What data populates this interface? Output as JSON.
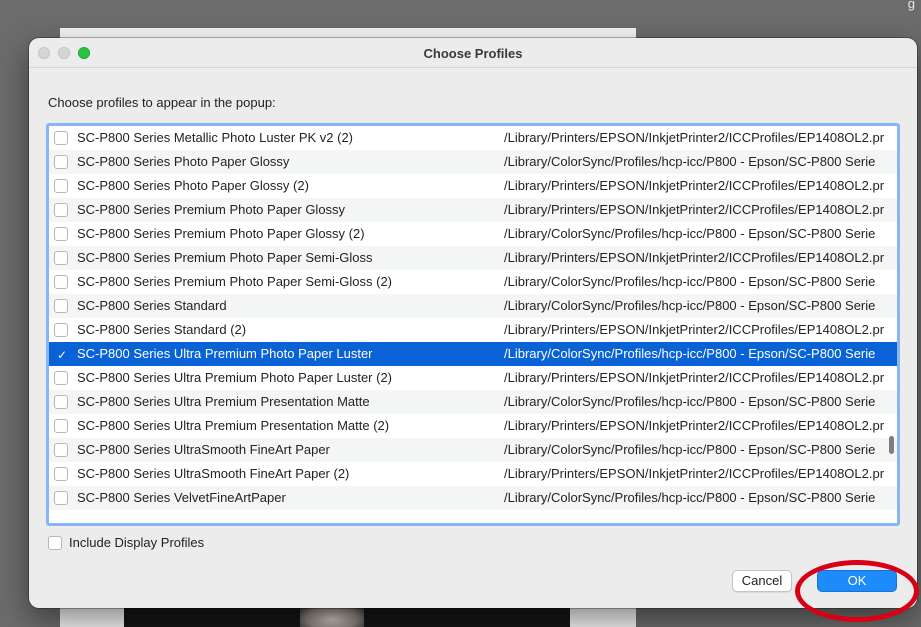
{
  "background": {
    "fragment_text": "g"
  },
  "dialog": {
    "title": "Choose Profiles",
    "prompt": "Choose profiles to appear in the popup:",
    "rows": [
      {
        "name": "SC-P800 Series Metallic Photo Luster PK v2 (2)",
        "path": "/Library/Printers/EPSON/InkjetPrinter2/ICCProfiles/EP1408OL2.pr",
        "checked": false
      },
      {
        "name": "SC-P800 Series Photo Paper Glossy",
        "path": "/Library/ColorSync/Profiles/hcp-icc/P800 - Epson/SC-P800 Serie",
        "checked": false
      },
      {
        "name": "SC-P800 Series Photo Paper Glossy (2)",
        "path": "/Library/Printers/EPSON/InkjetPrinter2/ICCProfiles/EP1408OL2.pr",
        "checked": false
      },
      {
        "name": "SC-P800 Series Premium Photo Paper Glossy",
        "path": "/Library/Printers/EPSON/InkjetPrinter2/ICCProfiles/EP1408OL2.pr",
        "checked": false
      },
      {
        "name": "SC-P800 Series Premium Photo Paper Glossy (2)",
        "path": "/Library/ColorSync/Profiles/hcp-icc/P800 - Epson/SC-P800 Serie",
        "checked": false
      },
      {
        "name": "SC-P800 Series Premium Photo Paper Semi-Gloss",
        "path": "/Library/Printers/EPSON/InkjetPrinter2/ICCProfiles/EP1408OL2.pr",
        "checked": false
      },
      {
        "name": "SC-P800 Series Premium Photo Paper Semi-Gloss (2)",
        "path": "/Library/ColorSync/Profiles/hcp-icc/P800 - Epson/SC-P800 Serie",
        "checked": false
      },
      {
        "name": "SC-P800 Series Standard",
        "path": "/Library/ColorSync/Profiles/hcp-icc/P800 - Epson/SC-P800 Serie",
        "checked": false
      },
      {
        "name": "SC-P800 Series Standard (2)",
        "path": "/Library/Printers/EPSON/InkjetPrinter2/ICCProfiles/EP1408OL2.pr",
        "checked": false
      },
      {
        "name": "SC-P800 Series Ultra Premium Photo Paper Luster",
        "path": "/Library/ColorSync/Profiles/hcp-icc/P800 - Epson/SC-P800 Serie",
        "checked": true,
        "selected": true
      },
      {
        "name": "SC-P800 Series Ultra Premium Photo Paper Luster (2)",
        "path": "/Library/Printers/EPSON/InkjetPrinter2/ICCProfiles/EP1408OL2.pr",
        "checked": false
      },
      {
        "name": "SC-P800 Series Ultra Premium Presentation Matte",
        "path": "/Library/ColorSync/Profiles/hcp-icc/P800 - Epson/SC-P800 Serie",
        "checked": false
      },
      {
        "name": "SC-P800 Series Ultra Premium Presentation Matte (2)",
        "path": "/Library/Printers/EPSON/InkjetPrinter2/ICCProfiles/EP1408OL2.pr",
        "checked": false
      },
      {
        "name": "SC-P800 Series UltraSmooth FineArt Paper",
        "path": "/Library/ColorSync/Profiles/hcp-icc/P800 - Epson/SC-P800 Serie",
        "checked": false
      },
      {
        "name": "SC-P800 Series UltraSmooth FineArt Paper (2)",
        "path": "/Library/Printers/EPSON/InkjetPrinter2/ICCProfiles/EP1408OL2.pr",
        "checked": false
      },
      {
        "name": "SC-P800 Series VelvetFineArtPaper",
        "path": "/Library/ColorSync/Profiles/hcp-icc/P800 - Epson/SC-P800 Serie",
        "checked": false
      }
    ],
    "include_display_profiles": {
      "label": "Include Display Profiles",
      "checked": false
    },
    "buttons": {
      "cancel": "Cancel",
      "ok": "OK"
    },
    "check_glyph": "✓"
  },
  "colors": {
    "selection": "#0a63d6",
    "ok_button": "#1e8bfa",
    "focus_ring": "#8ab5f5",
    "annotation": "#d90015"
  },
  "icons": [
    "close-button-icon",
    "minimize-button-icon",
    "zoom-button-icon",
    "checkmark-icon"
  ]
}
